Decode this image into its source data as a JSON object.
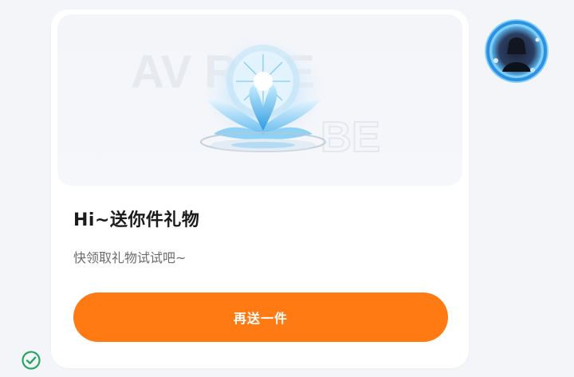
{
  "card": {
    "title": "Hi~送你件礼物",
    "subtitle": "快领取礼物试试吧~",
    "button_label": "再送一件"
  },
  "gift_image": {
    "icon": "crystal-lotus-gift-icon",
    "watermark": "AV    R  BE"
  },
  "avatar": {
    "icon": "user-avatar"
  },
  "status": {
    "icon": "check-circle-icon"
  },
  "colors": {
    "accent": "#ff7a12",
    "check": "#2aa564"
  }
}
